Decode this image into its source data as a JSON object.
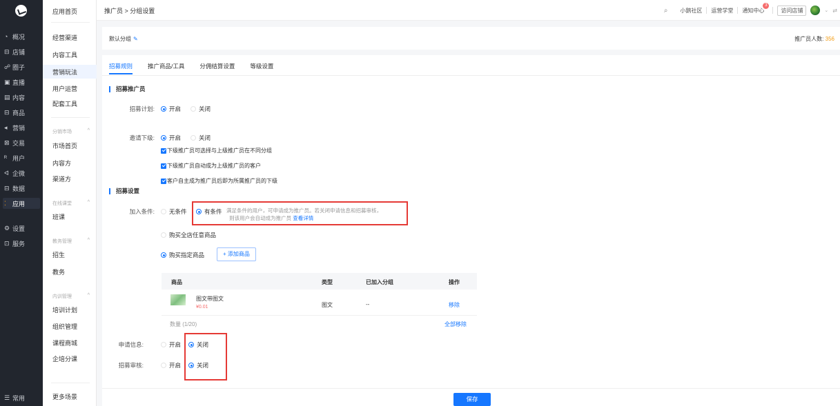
{
  "nav": {
    "items": [
      {
        "label": "概况",
        "icon": "dashboard-icon",
        "glyph": "◔"
      },
      {
        "label": "店铺",
        "icon": "store-icon",
        "glyph": "⊟"
      },
      {
        "label": "圈子",
        "icon": "community-icon",
        "glyph": "☍"
      },
      {
        "label": "直播",
        "icon": "live-icon",
        "glyph": "▣"
      },
      {
        "label": "内容",
        "icon": "content-icon",
        "glyph": "▤"
      },
      {
        "label": "商品",
        "icon": "goods-icon",
        "glyph": "⊟"
      },
      {
        "label": "营销",
        "icon": "marketing-icon",
        "glyph": "◂"
      },
      {
        "label": "交易",
        "icon": "trade-icon",
        "glyph": "⊠"
      },
      {
        "label": "用户",
        "icon": "user-icon",
        "glyph": "ᴿ"
      },
      {
        "label": "企微",
        "icon": "wecom-icon",
        "glyph": "ᐊ"
      },
      {
        "label": "数据",
        "icon": "data-icon",
        "glyph": "⊟"
      },
      {
        "label": "应用",
        "icon": "apps-icon",
        "glyph": "⁚"
      },
      {
        "label": "设置",
        "icon": "settings-icon",
        "glyph": "⚙"
      },
      {
        "label": "服务",
        "icon": "service-icon",
        "glyph": "⊡"
      },
      {
        "label": "常用",
        "icon": "frequent-icon",
        "glyph": "☰"
      }
    ]
  },
  "subnav": {
    "home": "应用首页",
    "items_top": [
      "经营渠道",
      "内容工具",
      "营销玩法",
      "用户运营",
      "配套工具"
    ],
    "group1": "分销市场",
    "group1_items": [
      "市场首页",
      "内容方",
      "渠道方"
    ],
    "group2": "在线课堂",
    "group2_items": [
      "班课"
    ],
    "group3": "教务管理",
    "group3_items": [
      "招生",
      "教务"
    ],
    "group4": "内训管理",
    "group4_items": [
      "培训计划",
      "组织管理",
      "课程商城",
      "企培分课"
    ],
    "more": "更多场景"
  },
  "topbar": {
    "breadcrumb": "推广员 > 分组设置",
    "links": [
      "小鹅社区",
      "运营学堂",
      "通知中心"
    ],
    "notify_badge": "3",
    "store": "访问店铺"
  },
  "group": {
    "name": "默认分组",
    "count_label": "推广员人数: ",
    "count": "356"
  },
  "tabs": [
    "招募规则",
    "推广商品/工具",
    "分佣结算设置",
    "等级设置"
  ],
  "section1": "招募推广员",
  "plan": {
    "label": "招募计划:",
    "on": "开启",
    "off": "关闭"
  },
  "invite": {
    "label": "邀请下级:",
    "on": "开启",
    "off": "关闭",
    "checks": [
      "下级推广员可选择与上级推广员在不同分组",
      "下级推广员自动成为上级推广员的客户",
      "客户自主成为推广员后即为所属推广员的下级"
    ]
  },
  "section2": "招募设置",
  "join": {
    "label": "加入条件:",
    "none": "无条件",
    "cond": "有条件",
    "desc1": "满足条件的用户，可申请成为推广员。若关闭申请信息和招募审核，",
    "desc2": "则该用户会自动成为推广员",
    "desc_link": "查看详情",
    "opt_any": "购买全店任意商品",
    "opt_spec": "购买指定商品",
    "add_btn": "+ 添加商品"
  },
  "table": {
    "headers": [
      "商品",
      "类型",
      "已加入分组",
      "操作"
    ],
    "rows": [
      {
        "name": "图文带图文",
        "price": "¥0.01",
        "type": "图文",
        "group": "--",
        "action": "移除"
      }
    ],
    "count": "数量 (1/20)",
    "remove_all": "全部移除"
  },
  "apply": {
    "label": "申请信息:",
    "on": "开启",
    "off": "关闭"
  },
  "review": {
    "label": "招募审核:",
    "on": "开启",
    "off": "关闭"
  },
  "save": "保存",
  "colors": {
    "accent": "#1677ff",
    "highlight": "#e53935",
    "nav_bg": "#22262e"
  }
}
